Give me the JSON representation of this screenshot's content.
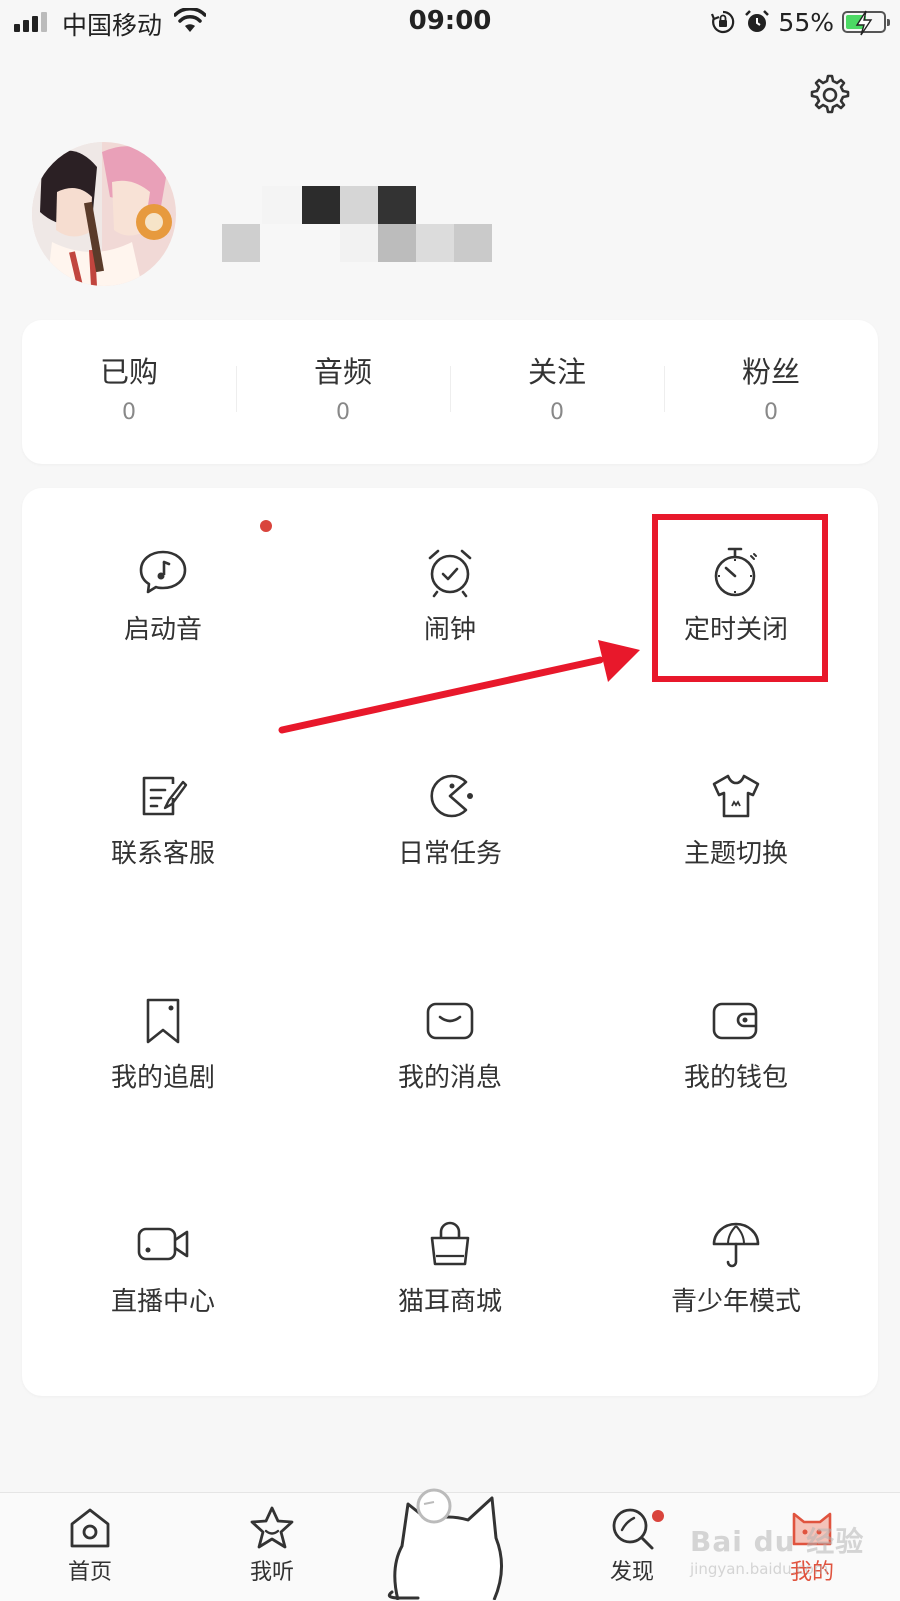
{
  "status_bar": {
    "carrier": "中国移动",
    "time": "09:00",
    "battery_percent_text": "55%",
    "battery_level": 0.55,
    "icons": [
      "signal-icon",
      "wifi-icon",
      "orientation-lock-icon",
      "alarm-icon",
      "battery-charging-icon"
    ]
  },
  "header": {
    "settings_icon": "gear-icon"
  },
  "stats": [
    {
      "label": "已购",
      "value": "0"
    },
    {
      "label": "音频",
      "value": "0"
    },
    {
      "label": "关注",
      "value": "0"
    },
    {
      "label": "粉丝",
      "value": "0"
    }
  ],
  "menu": [
    {
      "label": "启动音",
      "icon": "music-bubble-icon",
      "has_badge": true
    },
    {
      "label": "闹钟",
      "icon": "alarm-clock-icon"
    },
    {
      "label": "定时关闭",
      "icon": "stopwatch-icon",
      "highlighted": true
    },
    {
      "label": "联系客服",
      "icon": "edit-note-icon"
    },
    {
      "label": "日常任务",
      "icon": "pacman-icon"
    },
    {
      "label": "主题切换",
      "icon": "tshirt-icon"
    },
    {
      "label": "我的追剧",
      "icon": "bookmark-icon"
    },
    {
      "label": "我的消息",
      "icon": "message-box-icon"
    },
    {
      "label": "我的钱包",
      "icon": "wallet-icon"
    },
    {
      "label": "直播中心",
      "icon": "video-camera-icon"
    },
    {
      "label": "猫耳商城",
      "icon": "shopping-bag-icon"
    },
    {
      "label": "青少年模式",
      "icon": "umbrella-icon"
    }
  ],
  "tabbar": [
    {
      "label": "首页",
      "icon": "home-icon"
    },
    {
      "label": "我听",
      "icon": "star-icon"
    },
    {
      "label": "",
      "icon": "cat-icon"
    },
    {
      "label": "发现",
      "icon": "discover-search-icon"
    },
    {
      "label": "我的",
      "icon": "cat-face-icon",
      "active": true
    }
  ],
  "watermark": {
    "brand": "Bai du 经验",
    "url": "jingyan.baidu.com"
  },
  "colors": {
    "accent": "#e0533e",
    "highlight": "#e8182b",
    "badge": "#d9443c"
  }
}
